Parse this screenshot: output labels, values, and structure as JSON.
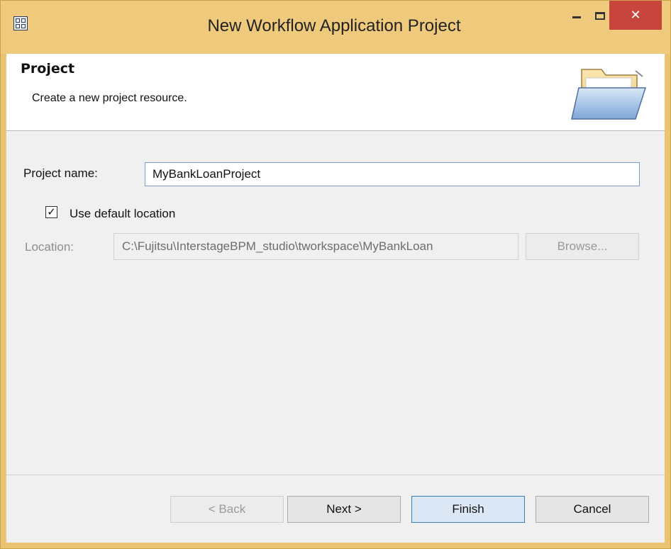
{
  "window": {
    "title": "New Workflow Application Project",
    "icons": {
      "app": "workflow-app-icon",
      "minimize": "minimize-icon",
      "maximize": "maximize-icon",
      "close": "close-icon"
    }
  },
  "banner": {
    "title": "Project",
    "description": "Create a new project resource.",
    "image": "open-folder-icon"
  },
  "form": {
    "project_name_label": "Project name:",
    "project_name_value": "MyBankLoanProject",
    "use_default_label": "Use default location",
    "use_default_checked": true,
    "location_label": "Location:",
    "location_value": "C:\\Fujitsu\\InterstageBPM_studio\\tworkspace\\MyBankLoan",
    "browse_label": "Browse..."
  },
  "buttons": {
    "back": "< Back",
    "next": "Next >",
    "finish": "Finish",
    "cancel": "Cancel"
  },
  "colors": {
    "titlebar": "#efca7d",
    "close": "#c7453c",
    "dialog_bg": "#f0f0f0",
    "banner_bg": "#ffffff"
  }
}
